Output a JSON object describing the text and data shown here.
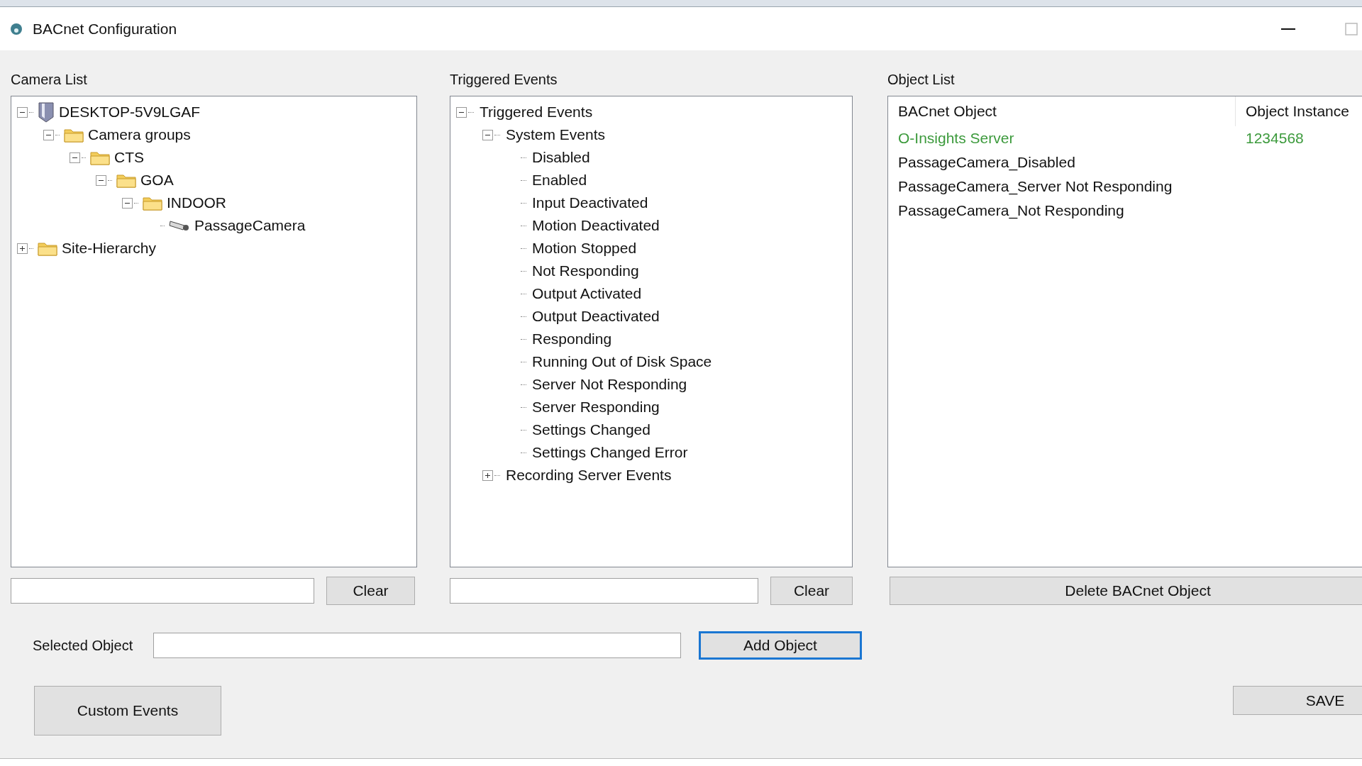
{
  "window": {
    "title": "BACnet Configuration"
  },
  "camera_list": {
    "label": "Camera List",
    "tree": [
      {
        "label": "DESKTOP-5V9LGAF",
        "kind": "server",
        "expanded": true,
        "children": [
          {
            "label": "Camera groups",
            "kind": "folder",
            "expanded": true,
            "children": [
              {
                "label": "CTS",
                "kind": "folder",
                "expanded": true,
                "children": [
                  {
                    "label": "GOA",
                    "kind": "folder",
                    "expanded": true,
                    "children": [
                      {
                        "label": "INDOOR",
                        "kind": "folder",
                        "expanded": true,
                        "children": [
                          {
                            "label": "PassageCamera",
                            "kind": "camera"
                          }
                        ]
                      }
                    ]
                  }
                ]
              }
            ]
          }
        ]
      },
      {
        "label": "Site-Hierarchy",
        "kind": "folder",
        "expanded": false
      }
    ],
    "clear_button": "Clear"
  },
  "triggered_events": {
    "label": "Triggered Events",
    "tree": [
      {
        "label": "Triggered Events",
        "kind": "event",
        "expanded": true,
        "children": [
          {
            "label": "System Events",
            "kind": "event",
            "expanded": true,
            "children": [
              {
                "label": "Disabled",
                "kind": "event"
              },
              {
                "label": "Enabled",
                "kind": "event"
              },
              {
                "label": "Input Deactivated",
                "kind": "event"
              },
              {
                "label": "Motion Deactivated",
                "kind": "event"
              },
              {
                "label": "Motion Stopped",
                "kind": "event"
              },
              {
                "label": "Not Responding",
                "kind": "event"
              },
              {
                "label": "Output Activated",
                "kind": "event"
              },
              {
                "label": "Output Deactivated",
                "kind": "event"
              },
              {
                "label": "Responding",
                "kind": "event"
              },
              {
                "label": "Running Out of Disk Space",
                "kind": "event"
              },
              {
                "label": "Server Not Responding",
                "kind": "event"
              },
              {
                "label": "Server Responding",
                "kind": "event"
              },
              {
                "label": "Settings Changed",
                "kind": "event"
              },
              {
                "label": "Settings Changed Error",
                "kind": "event"
              }
            ]
          },
          {
            "label": "Recording Server Events",
            "kind": "event",
            "expanded": false
          }
        ]
      }
    ],
    "clear_button": "Clear"
  },
  "object_list": {
    "label": "Object List",
    "columns": [
      "BACnet Object",
      "Object Instance"
    ],
    "rows": [
      {
        "cells": [
          "O-Insights Server",
          "1234568"
        ],
        "color": "#3c9a3c"
      },
      {
        "cells": [
          "PassageCamera_Disabled"
        ],
        "color": "#111111"
      },
      {
        "cells": [
          "PassageCamera_Server Not Responding"
        ],
        "color": "#111111"
      },
      {
        "cells": [
          "PassageCamera_Not Responding"
        ],
        "color": "#111111"
      }
    ],
    "delete_button": "Delete BACnet Object"
  },
  "selected_object": {
    "label": "Selected Object",
    "add_button": {
      "label": "Add Object",
      "focused": true
    }
  },
  "custom_events_button": "Custom Events",
  "save_button": "SAVE"
}
